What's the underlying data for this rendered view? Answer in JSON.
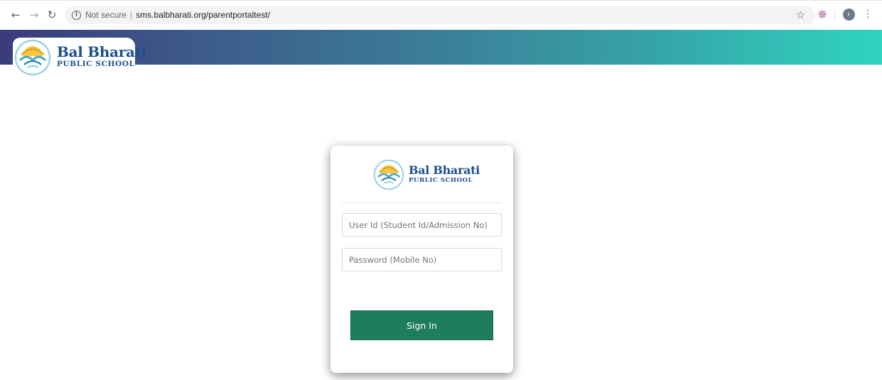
{
  "browser": {
    "security_label": "Not secure",
    "url": "sms.balbharati.org/parentportaltest/",
    "profile_initial": "r"
  },
  "header": {
    "logo_title": "Bal Bharati",
    "logo_subtitle": "PUBLIC SCHOOL"
  },
  "login": {
    "logo_title": "Bal Bharati",
    "logo_subtitle": "PUBLIC SCHOOL",
    "user_placeholder": "User Id (Student Id/Admission No)",
    "password_placeholder": "Password (Mobile No)",
    "signin_label": "Sign In"
  },
  "colors": {
    "header_start": "#3a3c7a",
    "header_end": "#2fd3c2",
    "signin_button": "#1e7d5e",
    "logo_text": "#1d4f8f"
  }
}
